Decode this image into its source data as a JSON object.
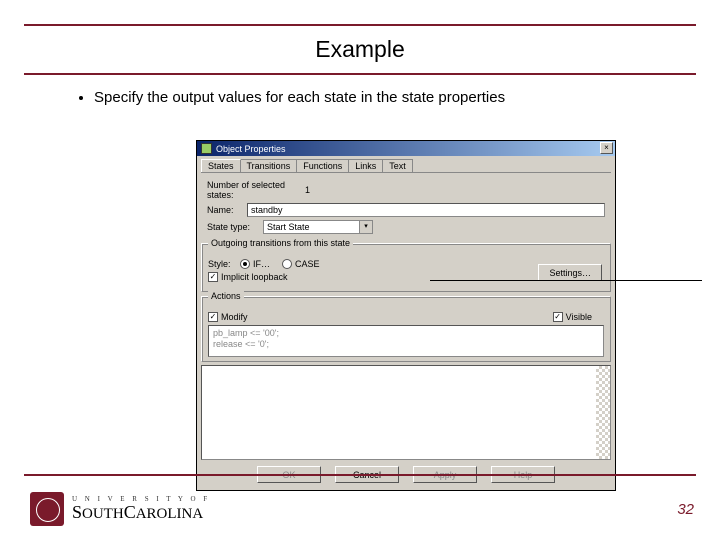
{
  "slide": {
    "title": "Example",
    "bullet": "Specify the output values for each state in the state properties",
    "page_number": "32"
  },
  "logo": {
    "line1": "U N I V E R S I T Y  O F",
    "line2_a": "S",
    "line2_b": "OUTH",
    "line2_c": "C",
    "line2_d": "AROLINA"
  },
  "dialog": {
    "title": "Object Properties",
    "tabs": [
      "States",
      "Transitions",
      "Functions",
      "Links",
      "Text"
    ],
    "num_states_label": "Number of selected states:",
    "num_states_value": "1",
    "name_label": "Name:",
    "name_value": "standby",
    "state_type_label": "State type:",
    "state_type_value": "Start State",
    "outgoing": {
      "legend": "Outgoing transitions from this state",
      "style_label": "Style:",
      "radio_if": "IF…",
      "radio_case": "CASE",
      "check_loopback": "Implicit loopback",
      "settings_btn": "Settings…"
    },
    "actions": {
      "legend": "Actions",
      "check_modify": "Modify",
      "check_visible": "Visible",
      "text": "pb_lamp <= '00';\nrelease <= '0';"
    },
    "buttons": {
      "ok": "OK",
      "cancel": "Cancel",
      "apply": "Apply",
      "help": "Help"
    }
  }
}
